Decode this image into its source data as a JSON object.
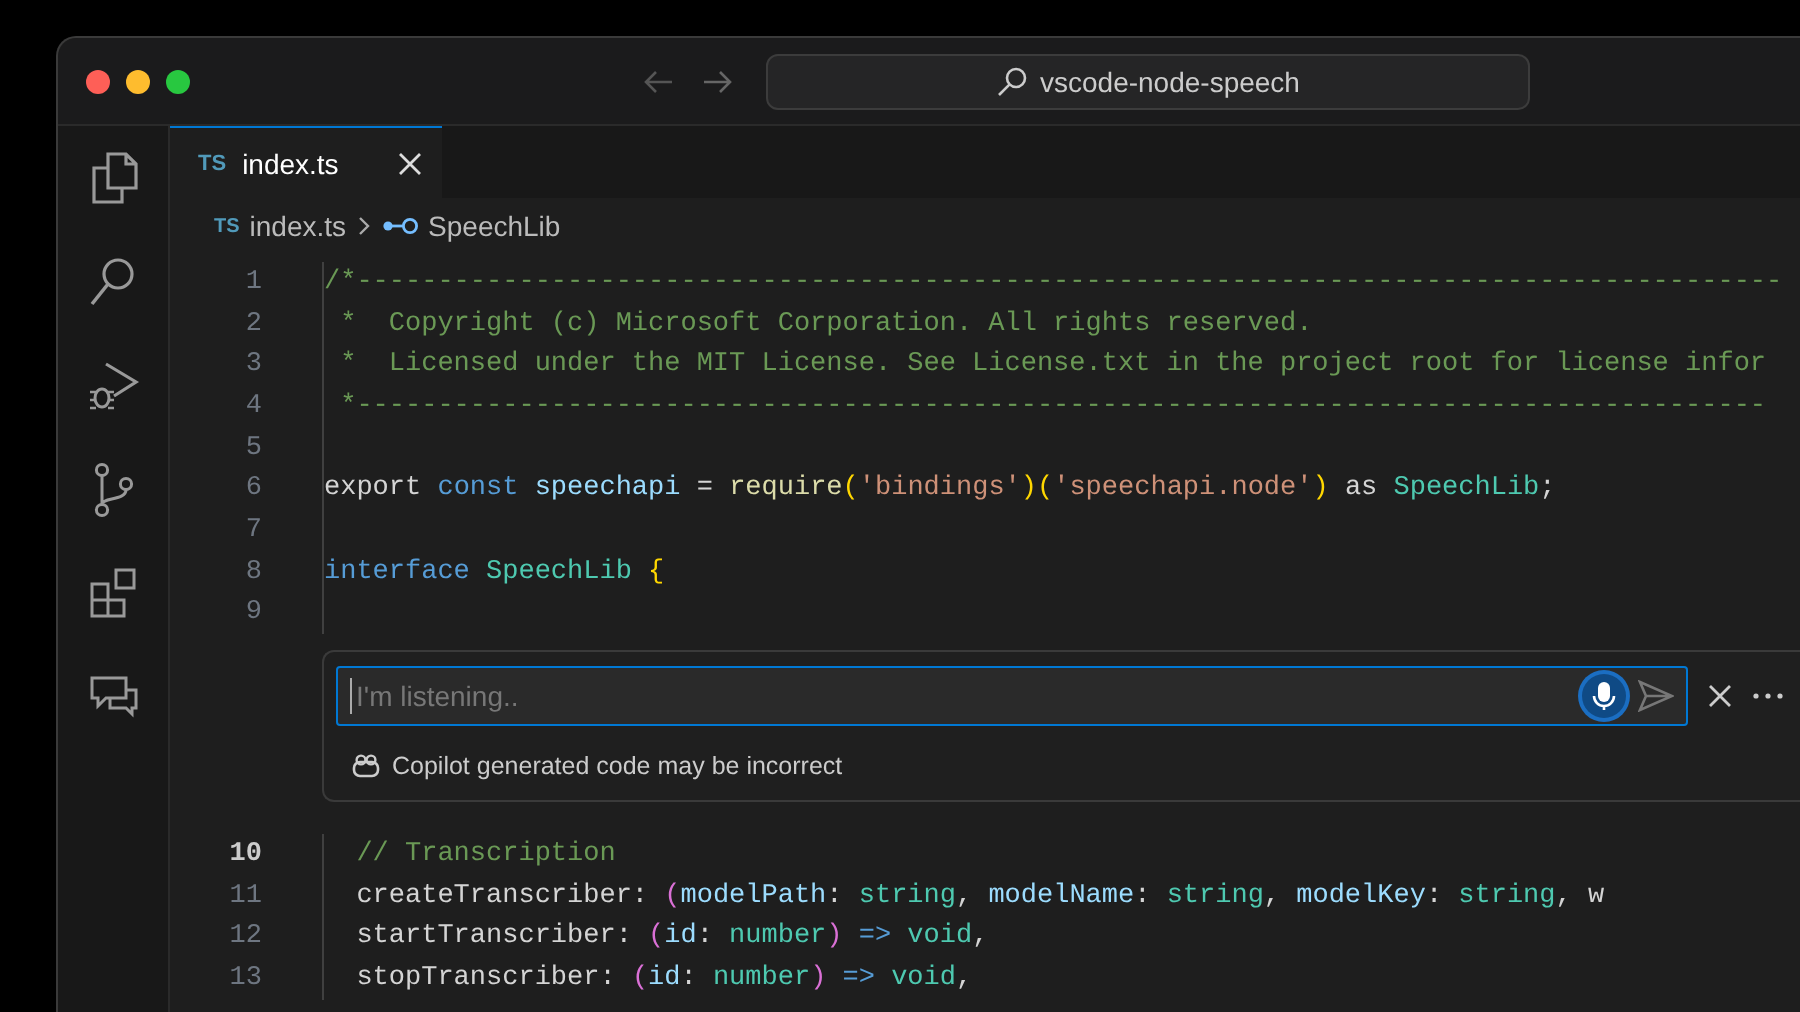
{
  "title_bar": {
    "search": "vscode-node-speech"
  },
  "tabs": [
    {
      "badge": "TS",
      "label": "index.ts",
      "selected": true
    }
  ],
  "breadcrumbs": [
    {
      "badge": "TS",
      "label": "index.ts",
      "kind": "file"
    },
    {
      "label": "SpeechLib",
      "kind": "symbol"
    }
  ],
  "code_before": [
    {
      "number": "1",
      "active": false,
      "tokens": [
        {
          "text": "/*----------------------------------------------------------------------------------------",
          "kind": "comment"
        }
      ]
    },
    {
      "number": "2",
      "active": false,
      "tokens": [
        {
          "text": " *  Copyright (c) Microsoft Corporation. All rights reserved.",
          "kind": "comment"
        }
      ]
    },
    {
      "number": "3",
      "active": false,
      "tokens": [
        {
          "text": " *  Licensed under the MIT License. See License.txt in the project root for license infor",
          "kind": "comment"
        }
      ]
    },
    {
      "number": "4",
      "active": false,
      "tokens": [
        {
          "text": " *---------------------------------------------------------------------------------------",
          "kind": "comment"
        }
      ]
    },
    {
      "number": "5",
      "active": false
    },
    {
      "number": "6",
      "active": false,
      "tokens": [
        {
          "text": "export ",
          "kind": "plain"
        },
        {
          "text": "const ",
          "kind": "keyword"
        },
        {
          "text": "speechapi",
          "kind": "variable"
        },
        {
          "text": " = ",
          "kind": "plain"
        },
        {
          "text": "require",
          "kind": "function"
        },
        {
          "text": "(",
          "kind": "bracket"
        },
        {
          "text": "'bindings'",
          "kind": "string"
        },
        {
          "text": ")(",
          "kind": "bracket"
        },
        {
          "text": "'speechapi.node'",
          "kind": "string"
        },
        {
          "text": ")",
          "kind": "bracket"
        },
        {
          "text": " as ",
          "kind": "plain"
        },
        {
          "text": "SpeechLib",
          "kind": "type"
        },
        {
          "text": ";",
          "kind": "plain"
        }
      ]
    },
    {
      "number": "7",
      "active": false
    },
    {
      "number": "8",
      "active": false,
      "tokens": [
        {
          "text": "interface ",
          "kind": "keyword"
        },
        {
          "text": "SpeechLib ",
          "kind": "type"
        },
        {
          "text": "{",
          "kind": "bracket"
        }
      ]
    },
    {
      "number": "9",
      "active": false
    }
  ],
  "inline_chat": {
    "placeholder": "I'm listening..",
    "listening": true,
    "notice": "Copilot generated code may be incorrect"
  },
  "code_after": [
    {
      "number": "10",
      "active": true,
      "tokens": [
        {
          "text": "  // Transcription",
          "kind": "comment"
        }
      ]
    },
    {
      "number": "11",
      "active": false,
      "tokens": [
        {
          "text": "  createTranscriber: ",
          "kind": "plain"
        },
        {
          "text": "(",
          "kind": "bracket2"
        },
        {
          "text": "modelPath",
          "kind": "variable"
        },
        {
          "text": ": ",
          "kind": "plain"
        },
        {
          "text": "string",
          "kind": "type"
        },
        {
          "text": ", ",
          "kind": "plain"
        },
        {
          "text": "modelName",
          "kind": "variable"
        },
        {
          "text": ": ",
          "kind": "plain"
        },
        {
          "text": "string",
          "kind": "type"
        },
        {
          "text": ", ",
          "kind": "plain"
        },
        {
          "text": "modelKey",
          "kind": "variable"
        },
        {
          "text": ": ",
          "kind": "plain"
        },
        {
          "text": "string",
          "kind": "type"
        },
        {
          "text": ", w",
          "kind": "plain"
        }
      ]
    },
    {
      "number": "12",
      "active": false,
      "tokens": [
        {
          "text": "  startTranscriber: ",
          "kind": "plain"
        },
        {
          "text": "(",
          "kind": "bracket2"
        },
        {
          "text": "id",
          "kind": "variable"
        },
        {
          "text": ": ",
          "kind": "plain"
        },
        {
          "text": "number",
          "kind": "type"
        },
        {
          "text": ")",
          "kind": "bracket2"
        },
        {
          "text": " => ",
          "kind": "keyword"
        },
        {
          "text": "void",
          "kind": "type"
        },
        {
          "text": ",",
          "kind": "plain"
        }
      ]
    },
    {
      "number": "13",
      "active": false,
      "tokens": [
        {
          "text": "  stopTranscriber: ",
          "kind": "plain"
        },
        {
          "text": "(",
          "kind": "bracket2"
        },
        {
          "text": "id",
          "kind": "variable"
        },
        {
          "text": ": ",
          "kind": "plain"
        },
        {
          "text": "number",
          "kind": "type"
        },
        {
          "text": ")",
          "kind": "bracket2"
        },
        {
          "text": " => ",
          "kind": "keyword"
        },
        {
          "text": "void",
          "kind": "type"
        },
        {
          "text": ",",
          "kind": "plain"
        }
      ]
    }
  ]
}
